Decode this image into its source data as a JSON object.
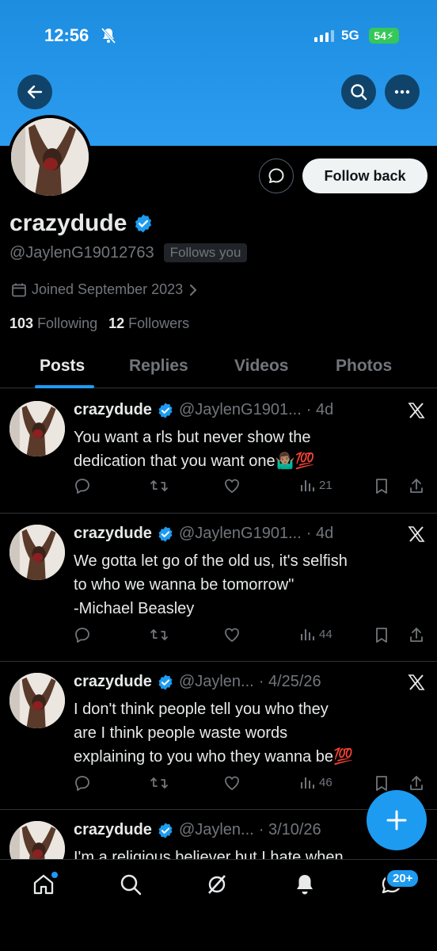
{
  "status_bar": {
    "time": "12:56",
    "network": "5G",
    "battery": "54"
  },
  "profile": {
    "display_name": "crazydude",
    "handle": "@JaylenG19012763",
    "follows_you": "Follows you",
    "joined": "Joined September 2023",
    "following_count": "103",
    "following_label": "Following",
    "followers_count": "12",
    "followers_label": "Followers",
    "follow_back_label": "Follow back"
  },
  "tabs": [
    {
      "label": "Posts",
      "active": true
    },
    {
      "label": "Replies",
      "active": false
    },
    {
      "label": "Videos",
      "active": false
    },
    {
      "label": "Photos",
      "active": false
    }
  ],
  "posts": [
    {
      "name": "crazydude",
      "handle": "@JaylenG1901...",
      "time": "· 4d",
      "text": "You want a rls but never show the\ndedication that you want one🤷🏽‍♂️💯",
      "views": "21"
    },
    {
      "name": "crazydude",
      "handle": "@JaylenG1901...",
      "time": "· 4d",
      "text": "We gotta let go of the old us, it's selfish\nto who we wanna be tomorrow\"\n-Michael Beasley",
      "views": "44"
    },
    {
      "name": "crazydude",
      "handle": "@Jaylen...",
      "time": "· 4/25/26",
      "text": "I don't think people tell you who they\nare I think people waste words\nexplaining to you who they wanna be💯",
      "views": "46"
    },
    {
      "name": "crazydude",
      "handle": "@Jaylen...",
      "time": "· 3/10/26",
      "text": "I'm a religious believer but I hate when",
      "views": ""
    }
  ],
  "bottom_nav": {
    "messages_badge": "20+"
  },
  "colors": {
    "accent": "#1d9bf0",
    "banner": "#2b9cf0",
    "background": "#000000"
  }
}
